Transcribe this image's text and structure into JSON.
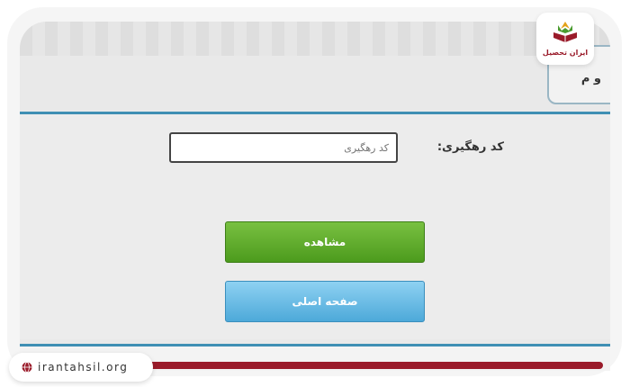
{
  "panel": {
    "tab_title": "و م"
  },
  "form": {
    "tracking_label": "کد رهگیری:",
    "tracking_placeholder": "کد رهگیری"
  },
  "buttons": {
    "view_label": "مشاهده",
    "home_label": "صفحه اصلی"
  },
  "branding": {
    "logo_text": "ایران تحصیل",
    "site_url": "irantahsil.org",
    "brand_color": "#9a1b2a",
    "accent_green": "#5aa82a",
    "accent_blue": "#5ab3e0"
  },
  "icons": {
    "logo": "book-logo-icon",
    "globe": "globe-icon"
  }
}
